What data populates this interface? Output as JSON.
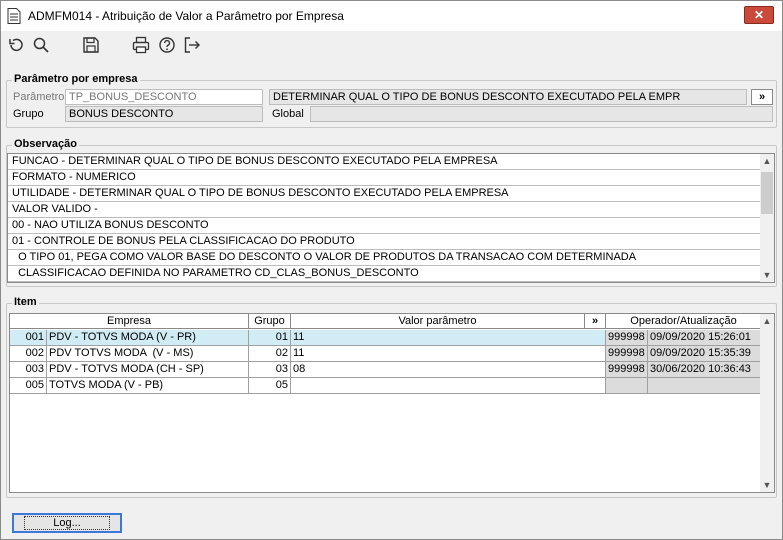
{
  "window": {
    "title": "ADMFM014 - Atribuição de Valor a Parâmetro por Empresa",
    "close_glyph": "✕"
  },
  "toolbar": {
    "icons": [
      "refresh-icon",
      "search-icon",
      "save-icon",
      "print-icon",
      "help-icon",
      "exit-icon"
    ]
  },
  "parametro": {
    "legend": "Parâmetro por empresa",
    "param_label": "Parâmetro",
    "param_value": "TP_BONUS_DESCONTO",
    "param_desc": "DETERMINAR QUAL O TIPO DE BONUS DESCONTO EXECUTADO PELA EMPR",
    "expand_label": "»",
    "grupo_label": "Grupo",
    "grupo_value": "BONUS DESCONTO",
    "global_label": "Global",
    "global_value": ""
  },
  "observacao": {
    "legend": "Observação",
    "lines": [
      "FUNCAO - DETERMINAR QUAL O TIPO DE BONUS DESCONTO EXECUTADO PELA EMPRESA",
      "FORMATO - NUMERICO",
      "UTILIDADE - DETERMINAR QUAL O TIPO DE BONUS DESCONTO EXECUTADO PELA EMPRESA",
      "VALOR VALIDO -",
      "00 -  NAO UTILIZA BONUS DESCONTO",
      "01 - CONTROLE DE BONUS PELA CLASSIFICACAO DO PRODUTO",
      "  O TIPO 01, PEGA COMO VALOR BASE DO DESCONTO O VALOR DE PRODUTOS DA TRANSACAO COM DETERMINADA",
      "  CLASSIFICACAO DEFINIDA NO PARAMETRO CD_CLAS_BONUS_DESCONTO"
    ]
  },
  "item": {
    "legend": "Item",
    "headers": {
      "empresa": "Empresa",
      "grupo": "Grupo",
      "valor": "Valor parâmetro",
      "expand": "»",
      "operador": "Operador/Atualização"
    },
    "rows": [
      {
        "cod": "001",
        "empresa": "PDV - TOTVS MODA (V - PR)",
        "grupo": "01",
        "valor": "11",
        "operador": "999998",
        "data": "09/09/2020 15:26:01"
      },
      {
        "cod": "002",
        "empresa": "PDV TOTVS MODA  (V - MS)",
        "grupo": "02",
        "valor": "11",
        "operador": "999998",
        "data": "09/09/2020 15:35:39"
      },
      {
        "cod": "003",
        "empresa": "PDV - TOTVS MODA (CH - SP)",
        "grupo": "03",
        "valor": "08",
        "operador": "999998",
        "data": "30/06/2020 10:36:43"
      },
      {
        "cod": "005",
        "empresa": "TOTVS MODA (V - PB)",
        "grupo": "05",
        "valor": "",
        "operador": "",
        "data": ""
      }
    ]
  },
  "footer": {
    "log_label": "Log..."
  }
}
